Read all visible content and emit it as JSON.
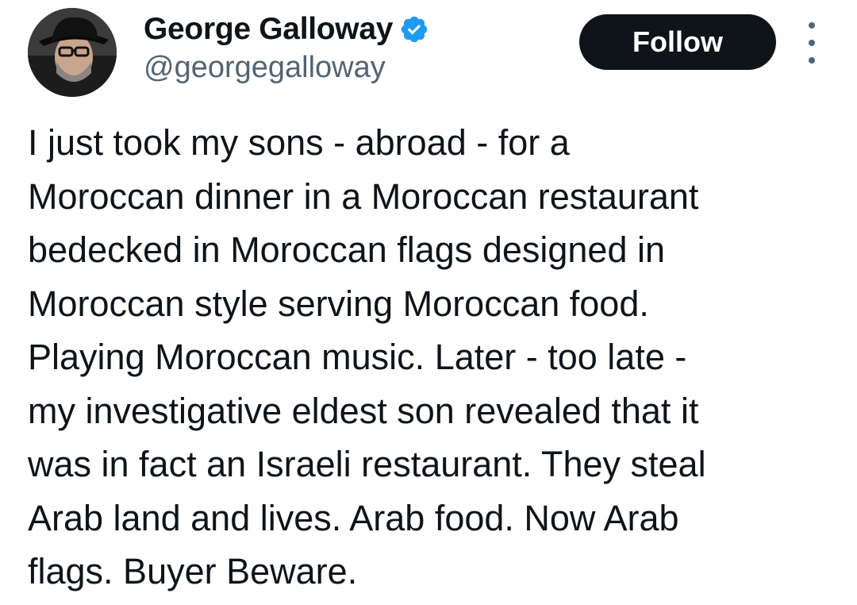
{
  "author": {
    "display_name": "George Galloway",
    "handle": "@georgegalloway",
    "verified": true,
    "avatar_icon": "profile-photo"
  },
  "actions": {
    "follow_label": "Follow",
    "more_icon": "more-vertical-icon"
  },
  "tweet": {
    "lines": [
      "I just took my sons - abroad - for a",
      "Moroccan dinner in a Moroccan restaurant",
      "bedecked in Moroccan flags designed in",
      "Moroccan style serving Moroccan food.",
      "Playing Moroccan music. Later - too late -",
      "my investigative eldest son revealed that it",
      "was in fact an Israeli restaurant. They steal",
      "Arab land and lives. Arab food. Now Arab",
      "flags. Buyer Beware."
    ]
  },
  "colors": {
    "text_primary": "#0f1419",
    "text_secondary": "#536471",
    "verified_blue": "#1d9bf0",
    "follow_bg": "#0f1419",
    "follow_text": "#ffffff"
  }
}
